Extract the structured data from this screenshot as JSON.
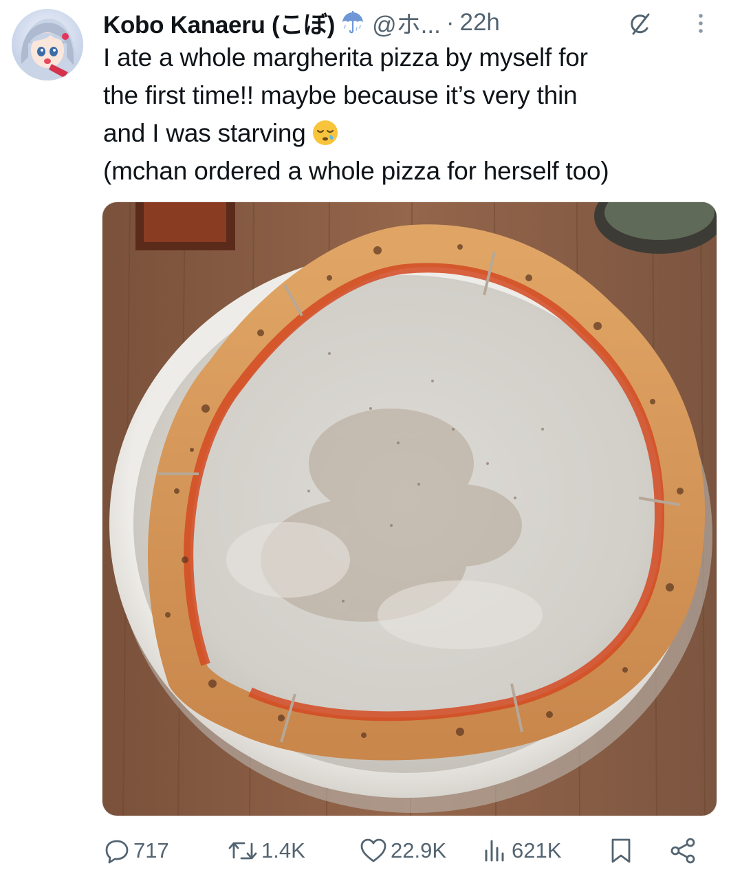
{
  "tweet": {
    "author": {
      "display_name": "Kobo Kanaeru (こぼ)",
      "handle": "@ホ...",
      "badge_icon": "umbrella-icon",
      "avatar_icon": "anime-avatar"
    },
    "separator": "·",
    "timestamp": "22h",
    "text_lines": [
      "I ate a whole margherita pizza by myself for",
      "the first time!! maybe because it’s very thin",
      "and I was starving",
      "(mchan ordered a whole pizza for herself too)"
    ],
    "emoji": "sleepy-face-emoji",
    "media": {
      "icon": "pizza-crust-photo"
    }
  },
  "actions": {
    "reply": {
      "icon": "reply-icon",
      "count": "717"
    },
    "retweet": {
      "icon": "retweet-icon",
      "count": "1.4K"
    },
    "like": {
      "icon": "heart-icon",
      "count": "22.9K"
    },
    "views": {
      "icon": "views-icon",
      "count": "621K"
    },
    "bookmark": {
      "icon": "bookmark-icon"
    },
    "share": {
      "icon": "share-icon"
    },
    "grok": {
      "icon": "grok-icon"
    },
    "more": {
      "icon": "more-icon"
    }
  },
  "colors": {
    "text_primary": "#0f1419",
    "text_secondary": "#536471",
    "background": "#ffffff",
    "wood_table": "#8a5f45",
    "plate": "#e7e4df",
    "crust": "#d99c5d",
    "sauce": "#d34a25"
  }
}
